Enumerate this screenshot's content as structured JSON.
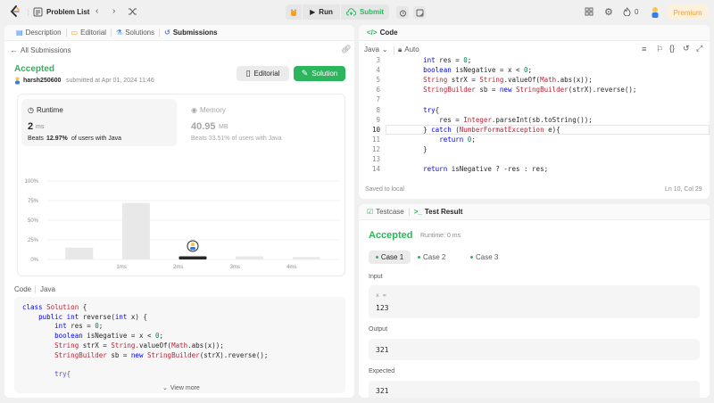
{
  "topbar": {
    "problem_list": "Problem List",
    "run": "Run",
    "submit": "Submit",
    "streak": "0",
    "premium": "Premium"
  },
  "left_tabs": [
    "Description",
    "Editorial",
    "Solutions",
    "Submissions"
  ],
  "submission": {
    "back_label": "All Submissions",
    "status": "Accepted",
    "user": "harsh250600",
    "submitted_text": "submitted at Apr 01, 2024 11:46",
    "editorial_btn": "Editorial",
    "solution_btn": "Solution",
    "runtime_label": "Runtime",
    "runtime_value": "2",
    "runtime_unit": "ms",
    "runtime_beats_prefix": "Beats",
    "runtime_beats_pct": "12.97%",
    "runtime_beats_suffix": "of users with Java",
    "memory_label": "Memory",
    "memory_value": "40.95",
    "memory_unit": "MB",
    "memory_beats": "Beats 33.51% of users with Java"
  },
  "chart_data": {
    "type": "bar",
    "y_ticks": [
      "100%",
      "75%",
      "50%",
      "25%",
      "0%"
    ],
    "x_ticks": [
      "1ms",
      "2ms",
      "3ms",
      "4ms"
    ],
    "mini_ticks": [
      "1ms",
      "2ms",
      "3ms",
      "4ms"
    ],
    "ylim": [
      0,
      100
    ],
    "values": [
      15,
      72,
      4,
      4,
      3
    ],
    "highlight_index": 2
  },
  "code_view": {
    "title": "Code",
    "lang": "Java",
    "view_more": "View more",
    "lines": [
      "class Solution {",
      "    public int reverse(int x) {",
      "        int res = 0;",
      "        boolean isNegative = x < 0;",
      "        String strX = String.valueOf(Math.abs(x));",
      "        StringBuilder sb = new StringBuilder(strX).reverse();",
      "",
      "        try{"
    ]
  },
  "editor": {
    "title": "Code",
    "lang": "Java",
    "auto": "Auto",
    "saved": "Saved to local",
    "position": "Ln 10, Col 29",
    "line_numbers": [
      "3",
      "4",
      "5",
      "6",
      "7",
      "8",
      "9",
      "10",
      "11",
      "12",
      "13",
      "14"
    ],
    "lines": [
      "        int res = 0;",
      "        boolean isNegative = x < 0;",
      "        String strX = String.valueOf(Math.abs(x));",
      "        StringBuilder sb = new StringBuilder(strX).reverse();",
      "",
      "        try{",
      "            res = Integer.parseInt(sb.toString());",
      "        } catch (NumberFormatException e){",
      "            return 0;",
      "        }",
      "",
      "        return isNegative ? -res : res;"
    ]
  },
  "result": {
    "testcase_tab": "Testcase",
    "result_tab": "Test Result",
    "status": "Accepted",
    "runtime": "Runtime: 0 ms",
    "cases": [
      "Case 1",
      "Case 2",
      "Case 3"
    ],
    "input_label": "Input",
    "input_var": "x =",
    "input_value": "123",
    "output_label": "Output",
    "output_value": "321",
    "expected_label": "Expected",
    "expected_value": "321"
  },
  "colors": {
    "accent_green": "#2db55d",
    "premium_bg": "#fdf1dc",
    "premium_text": "#e8a33d"
  }
}
